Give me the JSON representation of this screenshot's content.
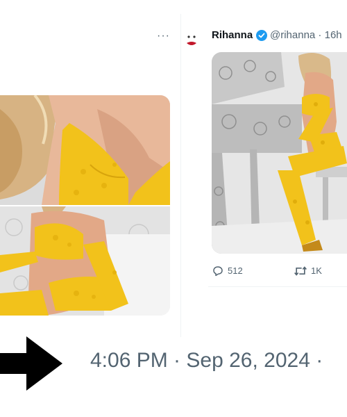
{
  "left_tweet": {
    "more_label": "···"
  },
  "right_tweet": {
    "author_name": "Rihanna",
    "handle_time": "@rihanna · 16h",
    "reply_count": "512",
    "retweet_count": "1K"
  },
  "bottom": {
    "timestamp": "4:06 PM · Sep 26, 2024 ·"
  },
  "colors": {
    "verified": "#1d9bf0",
    "secondary_text": "#536471",
    "lingerie_yellow": "#f2c21b"
  },
  "icons": [
    "more-dots-icon",
    "verified-badge-icon",
    "reply-icon",
    "retweet-icon",
    "arrow-icon"
  ]
}
